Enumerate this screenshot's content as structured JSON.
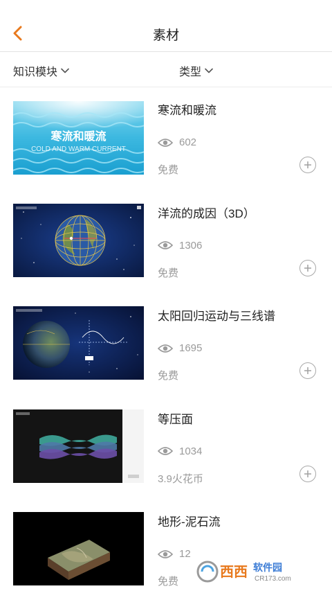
{
  "header": {
    "title": "素材",
    "back_icon": "chevron-left-icon",
    "accent_color": "#e8791d"
  },
  "filters": [
    {
      "label": "知识模块",
      "icon": "chevron-down-icon"
    },
    {
      "label": "类型",
      "icon": "chevron-down-icon"
    }
  ],
  "items": [
    {
      "title": "寒流和暖流",
      "views": "602",
      "price": "免费",
      "thumb_title": "寒流和暖流",
      "thumb_subtitle": "COLD AND WARM CURRENT"
    },
    {
      "title": "洋流的成因（3D）",
      "views": "1306",
      "price": "免费"
    },
    {
      "title": "太阳回归运动与三线谱",
      "views": "1695",
      "price": "免费"
    },
    {
      "title": "等压面",
      "views": "1034",
      "price": "3.9火花币"
    },
    {
      "title": "地形-泥石流",
      "views": "12",
      "price": "免费"
    }
  ],
  "watermark": {
    "text": "西西",
    "sub": "软件园",
    "url": "CR173.com"
  }
}
